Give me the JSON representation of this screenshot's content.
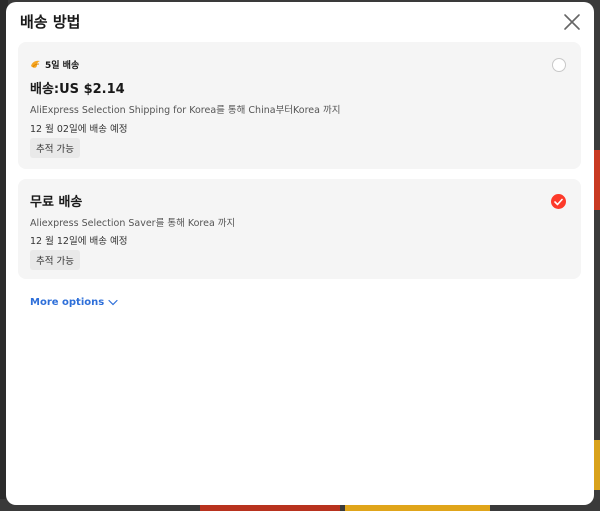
{
  "modal": {
    "title": "배송 방법",
    "close_icon": "close-icon"
  },
  "options": [
    {
      "badge_icon": "fast-delivery-icon",
      "badge": "5일 배송",
      "price": "배송:US $2.14",
      "route": "AliExpress Selection Shipping for Korea를 통해 China부터Korea 까지",
      "delivery": "12 월 02일에 배송 예정",
      "tag": "추적 가능",
      "selected": false
    },
    {
      "title": "무료 배송",
      "route": "Aliexpress Selection Saver를 통해 Korea 까지",
      "delivery": "12 월 12일에 배송 예정",
      "tag": "추적 가능",
      "selected": true
    }
  ],
  "more_options": {
    "label": "More options",
    "icon": "chevron-down-icon"
  },
  "colors": {
    "accent_red": "#fd3a2a",
    "link_blue": "#2e6fd9",
    "badge_orange": "#f5a623"
  }
}
